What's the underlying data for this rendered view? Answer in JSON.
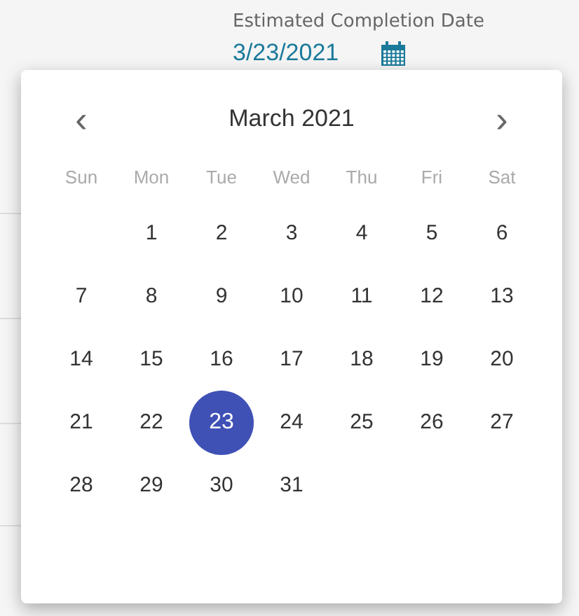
{
  "field": {
    "label": "Estimated Completion Date",
    "value": "3/23/2021"
  },
  "calendar": {
    "prev": "‹",
    "next": "›",
    "month": "March 2021",
    "weekdays": [
      "Sun",
      "Mon",
      "Tue",
      "Wed",
      "Thu",
      "Fri",
      "Sat"
    ],
    "weeks": [
      [
        {
          "label": "1",
          "selected": false
        },
        {
          "label": "2",
          "selected": false
        },
        {
          "label": "3",
          "selected": false
        },
        {
          "label": "4",
          "selected": false
        },
        {
          "label": "5",
          "selected": false
        },
        {
          "label": "6",
          "selected": false
        }
      ],
      [
        {
          "label": "7",
          "selected": false
        },
        {
          "label": "8",
          "selected": false
        },
        {
          "label": "9",
          "selected": false
        },
        {
          "label": "10",
          "selected": false
        },
        {
          "label": "11",
          "selected": false
        },
        {
          "label": "12",
          "selected": false
        },
        {
          "label": "13",
          "selected": false
        }
      ],
      [
        {
          "label": "14",
          "selected": false
        },
        {
          "label": "15",
          "selected": false
        },
        {
          "label": "16",
          "selected": false
        },
        {
          "label": "17",
          "selected": false
        },
        {
          "label": "18",
          "selected": false
        },
        {
          "label": "19",
          "selected": false
        },
        {
          "label": "20",
          "selected": false
        }
      ],
      [
        {
          "label": "21",
          "selected": false
        },
        {
          "label": "22",
          "selected": false
        },
        {
          "label": "23",
          "selected": true
        },
        {
          "label": "24",
          "selected": false
        },
        {
          "label": "25",
          "selected": false
        },
        {
          "label": "26",
          "selected": false
        },
        {
          "label": "27",
          "selected": false
        }
      ],
      [
        {
          "label": "28",
          "selected": false
        },
        {
          "label": "29",
          "selected": false
        },
        {
          "label": "30",
          "selected": false
        },
        {
          "label": "31",
          "selected": false
        }
      ]
    ]
  }
}
